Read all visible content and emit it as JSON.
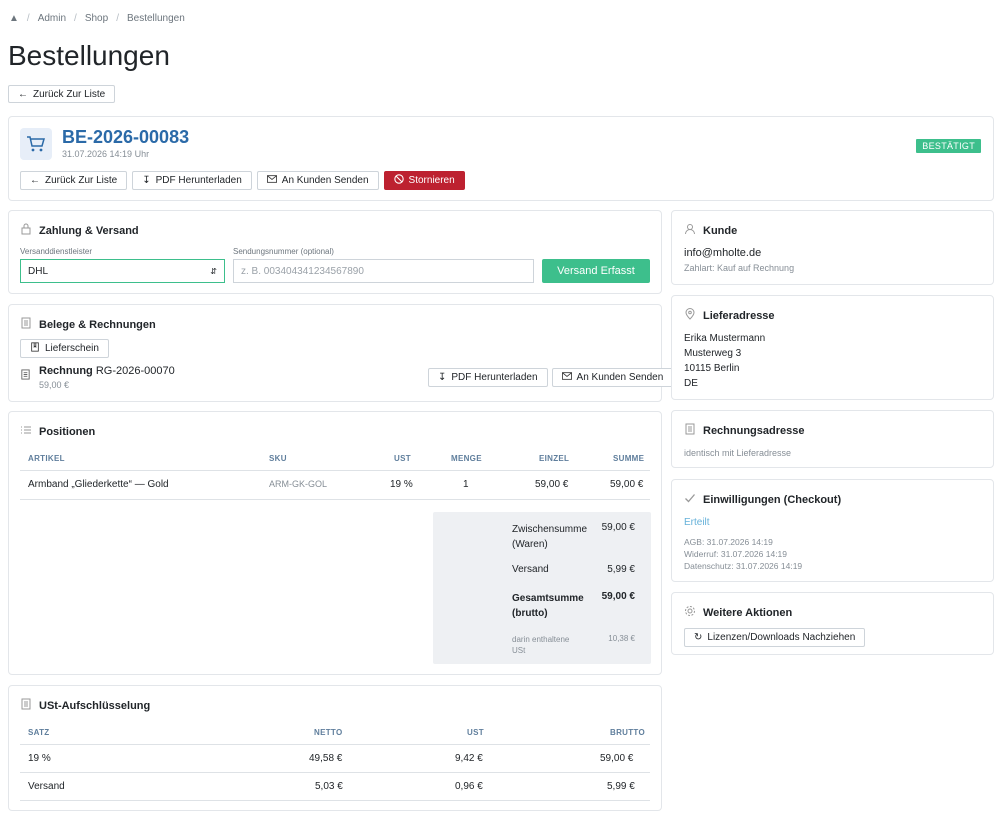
{
  "breadcrumb": {
    "items": [
      "Admin",
      "Shop",
      "Bestellungen"
    ]
  },
  "page_title": "Bestellungen",
  "back_label": "Zurück Zur Liste",
  "order": {
    "number": "BE-2026-00083",
    "datetime": "31.07.2026 14:19 Uhr",
    "status": "BESTÄTIGT",
    "actions": {
      "back": "Zurück Zur Liste",
      "pdf": "PDF Herunterladen",
      "send": "An Kunden Senden",
      "cancel": "Stornieren"
    }
  },
  "shipping": {
    "title": "Zahlung & Versand",
    "carrier_label": "Versanddienstleister",
    "carrier_value": "DHL",
    "tracking_label": "Sendungsnummer (optional)",
    "tracking_placeholder": "z. B. 003404341234567890",
    "submit": "Versand Erfasst"
  },
  "documents": {
    "title": "Belege & Rechnungen",
    "delivery_note": "Lieferschein",
    "invoice_label": "Rechnung",
    "invoice_number": "RG-2026-00070",
    "invoice_amount": "59,00 €",
    "pdf": "PDF Herunterladen",
    "send": "An Kunden Senden"
  },
  "positions": {
    "title": "Positionen",
    "headers": [
      "ARTIKEL",
      "SKU",
      "UST",
      "MENGE",
      "EINZEL",
      "SUMME"
    ],
    "rows": [
      {
        "artikel": "Armband „Gliederkette“ — Gold",
        "sku": "ARM-GK-GOL",
        "ust": "19 %",
        "menge": "1",
        "einzel": "59,00 €",
        "summe": "59,00 €"
      }
    ],
    "totals": {
      "subtotal_label": "Zwischensumme (Waren)",
      "subtotal": "59,00 €",
      "shipping_label": "Versand",
      "shipping": "5,99 €",
      "total_label": "Gesamtsumme (brutto)",
      "total": "59,00 €",
      "vat_label": "darin enthaltene USt",
      "vat": "10,38 €"
    }
  },
  "vat_breakdown": {
    "title": "USt-Aufschlüsselung",
    "headers": [
      "SATZ",
      "NETTO",
      "UST",
      "BRUTTO"
    ],
    "rows": [
      {
        "satz": "19 %",
        "netto": "49,58 €",
        "ust": "9,42 €",
        "brutto": "59,00 €"
      },
      {
        "satz": "Versand",
        "netto": "5,03 €",
        "ust": "0,96 €",
        "brutto": "5,99 €"
      }
    ]
  },
  "customer": {
    "title": "Kunde",
    "email": "info@mholte.de",
    "payment": "Zahlart: Kauf auf Rechnung"
  },
  "delivery_address": {
    "title": "Lieferadresse",
    "lines": [
      "Erika Mustermann",
      "Musterweg 3",
      "10115 Berlin",
      "DE"
    ]
  },
  "billing_address": {
    "title": "Rechnungsadresse",
    "text": "identisch mit Lieferadresse"
  },
  "consents": {
    "title": "Einwilligungen (Checkout)",
    "status": "Erteilt",
    "agb": "AGB: 31.07.2026 14:19",
    "widerruf": "Widerruf: 31.07.2026 14:19",
    "datenschutz": "Datenschutz: 31.07.2026 14:19"
  },
  "more_actions": {
    "title": "Weitere Aktionen",
    "button": "Lizenzen/Downloads Nachziehen"
  },
  "colors": {
    "accent": "#3dbf8c",
    "danger": "#bd2130",
    "order_number": "#2b6aa8",
    "link": "#65b1d9"
  }
}
